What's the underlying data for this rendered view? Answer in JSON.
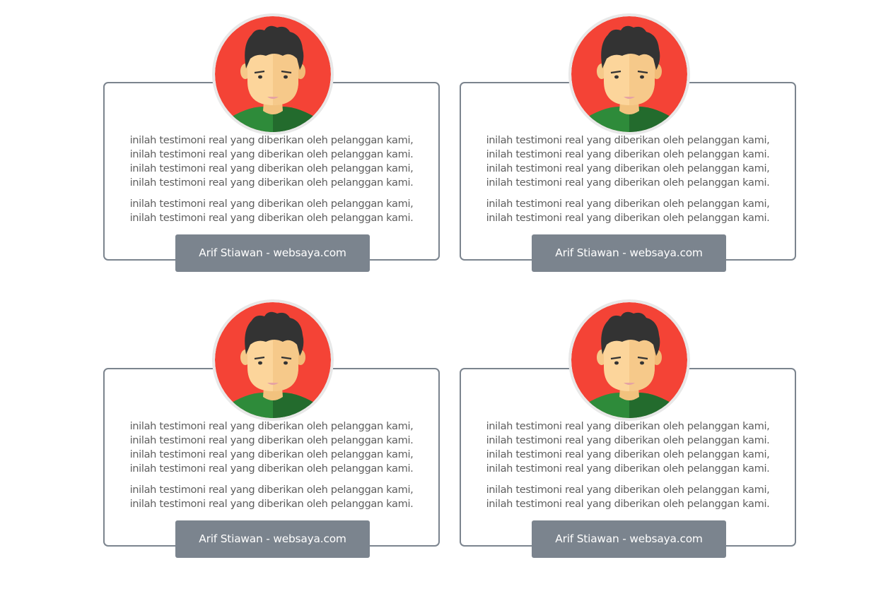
{
  "testimonials": [
    {
      "paragraph_1": [
        "inilah testimoni real yang diberikan oleh pelanggan kami,",
        "inilah testimoni real yang diberikan oleh pelanggan kami.",
        "inilah testimoni real yang diberikan oleh pelanggan kami,",
        "inilah testimoni real yang diberikan oleh pelanggan kami."
      ],
      "paragraph_2": [
        "inilah testimoni real yang diberikan oleh pelanggan kami,",
        "inilah testimoni real yang diberikan oleh pelanggan kami."
      ],
      "author": "Arif Stiawan - websaya.com"
    },
    {
      "paragraph_1": [
        "inilah testimoni real yang diberikan oleh pelanggan kami,",
        "inilah testimoni real yang diberikan oleh pelanggan kami.",
        "inilah testimoni real yang diberikan oleh pelanggan kami,",
        "inilah testimoni real yang diberikan oleh pelanggan kami."
      ],
      "paragraph_2": [
        "inilah testimoni real yang diberikan oleh pelanggan kami,",
        "inilah testimoni real yang diberikan oleh pelanggan kami."
      ],
      "author": "Arif Stiawan - websaya.com"
    },
    {
      "paragraph_1": [
        "inilah testimoni real yang diberikan oleh pelanggan kami,",
        "inilah testimoni real yang diberikan oleh pelanggan kami.",
        "inilah testimoni real yang diberikan oleh pelanggan kami,",
        "inilah testimoni real yang diberikan oleh pelanggan kami."
      ],
      "paragraph_2": [
        "inilah testimoni real yang diberikan oleh pelanggan kami,",
        "inilah testimoni real yang diberikan oleh pelanggan kami."
      ],
      "author": "Arif Stiawan - websaya.com"
    },
    {
      "paragraph_1": [
        "inilah testimoni real yang diberikan oleh pelanggan kami,",
        "inilah testimoni real yang diberikan oleh pelanggan kami.",
        "inilah testimoni real yang diberikan oleh pelanggan kami,",
        "inilah testimoni real yang diberikan oleh pelanggan kami."
      ],
      "paragraph_2": [
        "inilah testimoni real yang diberikan oleh pelanggan kami,",
        "inilah testimoni real yang diberikan oleh pelanggan kami."
      ],
      "author": "Arif Stiawan - websaya.com"
    }
  ],
  "colors": {
    "card_border": "#7b848e",
    "author_badge": "#7b848e",
    "body_text": "#5e5e5e",
    "avatar_background": "#f44336",
    "avatar_ring": "#e8e8e8",
    "avatar_hair": "#333333",
    "avatar_skin": "#fcd59b",
    "avatar_shirt": "#2e8b3a"
  },
  "icons": {
    "avatar": "male-avatar-icon"
  }
}
